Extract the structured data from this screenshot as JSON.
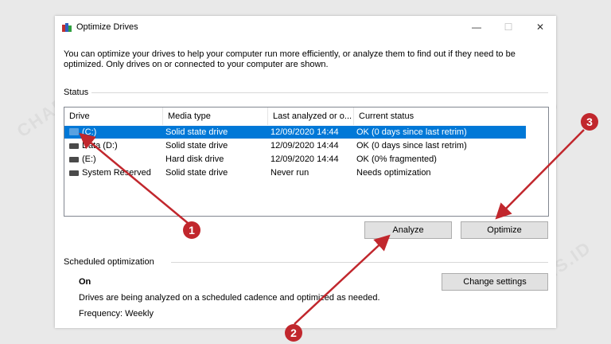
{
  "window": {
    "title": "Optimize Drives",
    "minimize_glyph": "—",
    "maximize_glyph": "☐",
    "close_glyph": "✕"
  },
  "intro_text": "You can optimize your drives to help your computer run more efficiently, or analyze them to find out if they need to be optimized. Only drives on or connected to your computer are shown.",
  "status": {
    "label": "Status",
    "columns": [
      "Drive",
      "Media type",
      "Last analyzed or o...",
      "Current status"
    ],
    "rows": [
      {
        "drive": "(C:)",
        "media": "Solid state drive",
        "last": "12/09/2020 14:44",
        "status": "OK (0 days since last retrim)",
        "selected": true
      },
      {
        "drive": "Data (D:)",
        "media": "Solid state drive",
        "last": "12/09/2020 14:44",
        "status": "OK (0 days since last retrim)",
        "selected": false
      },
      {
        "drive": "(E:)",
        "media": "Hard disk drive",
        "last": "12/09/2020 14:44",
        "status": "OK (0% fragmented)",
        "selected": false
      },
      {
        "drive": "System Reserved",
        "media": "Solid state drive",
        "last": "Never run",
        "status": "Needs optimization",
        "selected": false
      }
    ]
  },
  "buttons": {
    "analyze": "Analyze",
    "optimize": "Optimize",
    "change_settings": "Change settings"
  },
  "scheduled": {
    "label": "Scheduled optimization",
    "state": "On",
    "description": "Drives are being analyzed on a scheduled cadence and optimized as needed.",
    "frequency": "Frequency: Weekly"
  },
  "annotations": {
    "marker1": "1",
    "marker2": "2",
    "marker3": "3",
    "watermark": "CHARISIS.ID",
    "color": "#c1272d"
  }
}
